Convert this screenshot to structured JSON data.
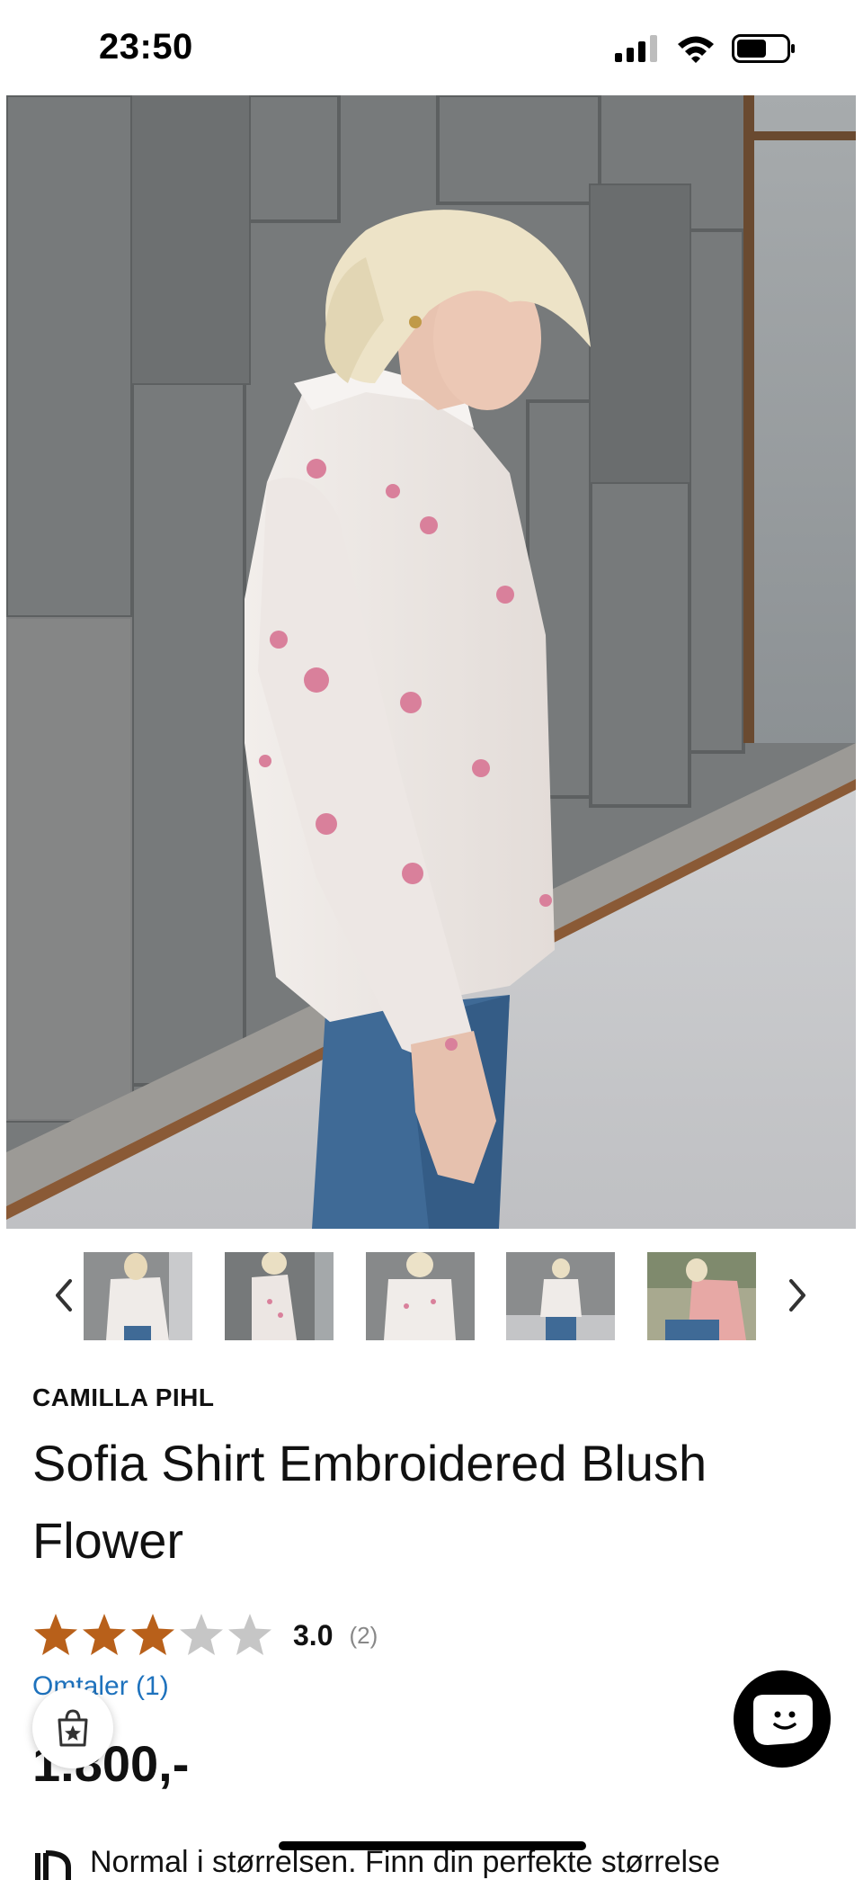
{
  "status_bar": {
    "time": "23:50"
  },
  "product": {
    "brand": "CAMILLA PIHL",
    "title": "Sofia Shirt Embroidered Blush Flower",
    "rating": {
      "value": "3.0",
      "count": "(2)",
      "stars_filled": 3,
      "stars_total": 5,
      "star_color": "#b8601a",
      "star_empty_color": "#c6c6c6"
    },
    "reviews_link": "Omtaler (1)",
    "price": "1.800,-"
  },
  "gallery": {
    "thumbnail_count": 5,
    "prev_icon": "chevron-left-icon",
    "next_icon": "chevron-right-icon"
  },
  "size_hint": {
    "text": "Normal i størrelsen. Finn din perfekte størrelse"
  },
  "floating": {
    "store_icon": "shopping-bag-star-icon",
    "chat_icon": "chat-smiley-icon"
  },
  "colors": {
    "link": "#1e72bd",
    "text": "#111111",
    "chat_bg": "#000000"
  }
}
